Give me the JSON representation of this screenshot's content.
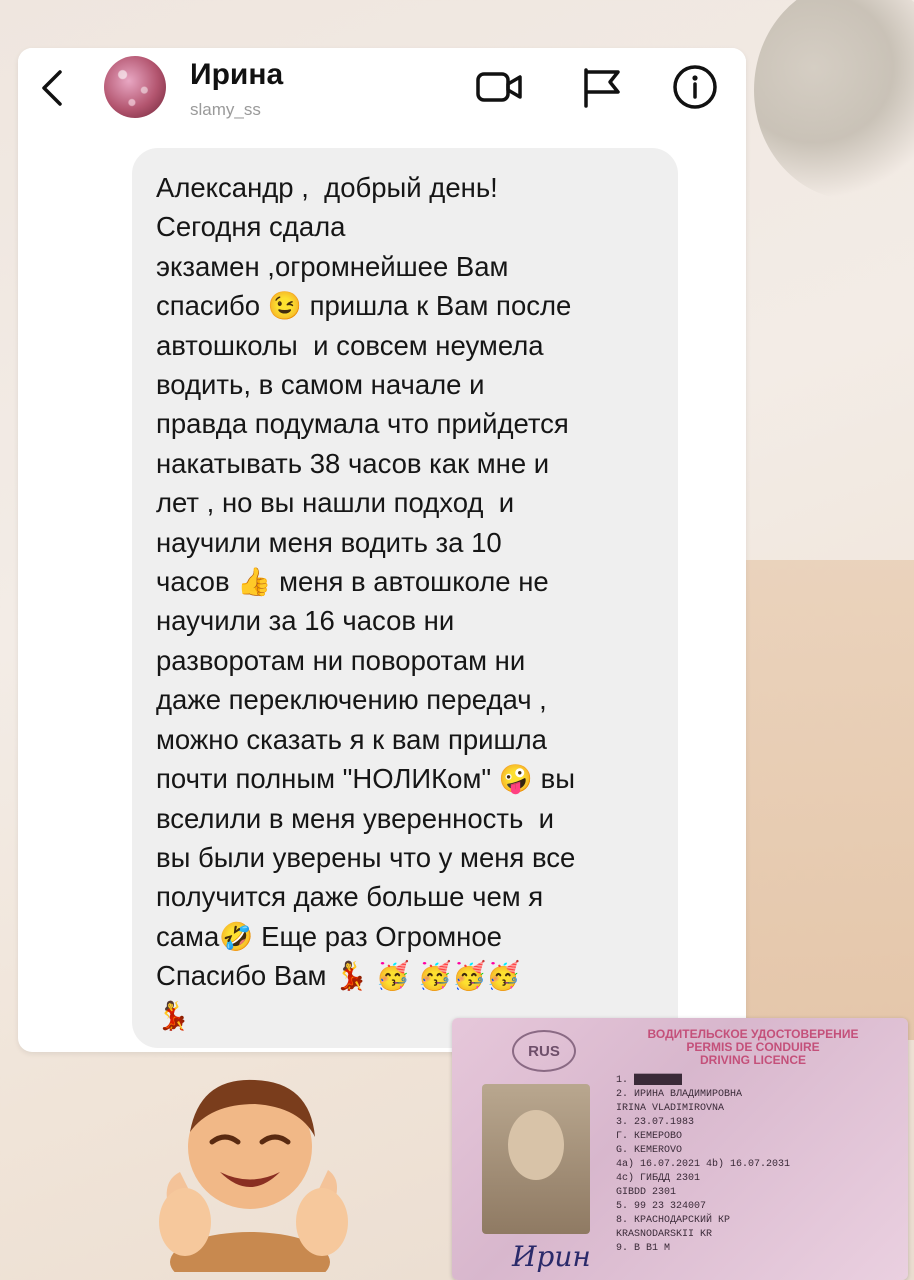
{
  "header": {
    "name": "Ирина",
    "username": "slamy_ss"
  },
  "message": {
    "text": "Александр ,  добрый день!\nСегодня сдала\nэкзамен ,огромнейшее Вам\nспасибо 😉 пришла к Вам после\nавтошколы  и совсем неумела\nводить, в самом начале и\nправда подумала что прийдется\nнакатывать 38 часов как мне и\nлет , но вы нашли подход  и\nнаучили меня водить за 10\nчасов 👍 меня в автошколе не\nнаучили за 16 часов ни\nразворотам ни поворотам ни\nдаже переключению передач ,\nможно сказать я к вам пришла\nпочти полным \"НОЛИКом\" 🤪 вы\nвселили в меня уверенность  и\nвы были уверены что у меня все\nполучится даже больше чем я\nсама🤣 Еще раз Огромное\nСпасибо Вам 💃 🥳 🥳🥳🥳\n💃"
  },
  "license": {
    "country": "RUS",
    "title_lines": [
      "ВОДИТЕЛЬСКОЕ УДОСТОВЕРЕНИЕ",
      "PERMIS DE CONDUIRE",
      "DRIVING LICENCE"
    ],
    "fields": [
      "1.  ████████",
      "2.  ИРИНА ВЛАДИМИРОВНА",
      "    IRINA VLADIMIROVNA",
      "3.  23.07.1983",
      "    Г. КЕМЕРОВО",
      "    G. KEMEROVO",
      "4a) 16.07.2021   4b) 16.07.2031",
      "4c) ГИБДД 2301",
      "    GIBDD 2301",
      "5.  99 23 324007",
      "8.  КРАСНОДАРСКИЙ КР",
      "    KRASNODARSKII KR",
      "9.  B  B1  M"
    ],
    "signature": "Ирин"
  }
}
